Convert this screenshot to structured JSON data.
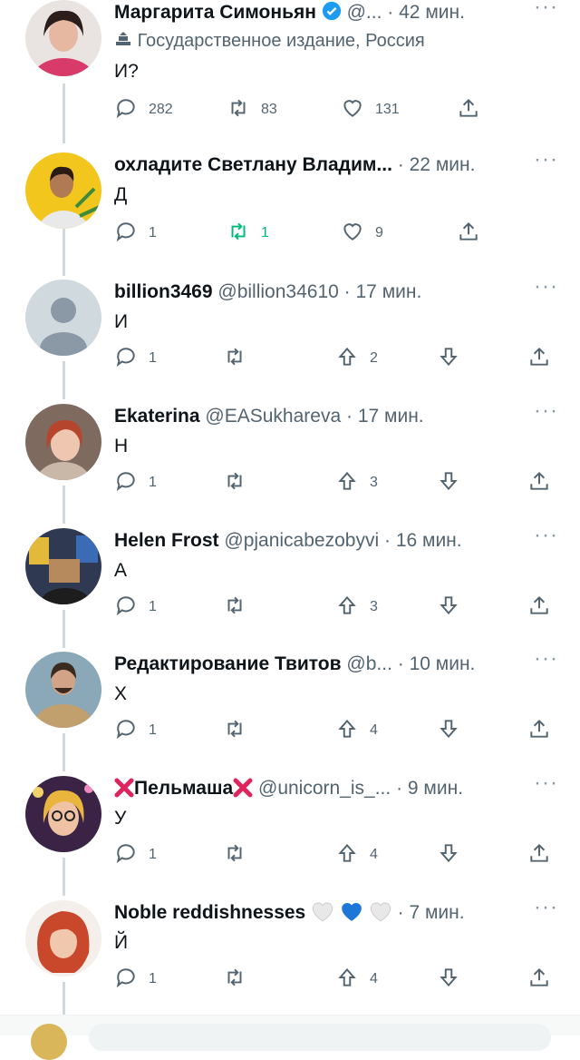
{
  "tweets": [
    {
      "name": "Маргарита Симоньян",
      "verified": true,
      "handle": "@...",
      "time": "42 мин.",
      "label": "Государственное издание, Россия",
      "text": "И?",
      "actions": {
        "replies": "282",
        "retweets": "83",
        "likes": "131"
      }
    },
    {
      "name": "охладите Светлану Владим...",
      "time": "22 мин.",
      "text": "Д",
      "actions": {
        "replies": "1",
        "retweets": "1",
        "likes": "9"
      },
      "retweet_active_color": "#00ba7c"
    },
    {
      "name": "billion3469",
      "handle": "@billion34610",
      "time": "17 мин.",
      "text": "И",
      "actions": {
        "replies": "1",
        "upvotes": "2"
      }
    },
    {
      "name": "Ekaterina",
      "handle": "@EASukhareva",
      "time": "17 мин.",
      "text": "Н",
      "actions": {
        "replies": "1",
        "upvotes": "3"
      }
    },
    {
      "name": "Helen Frost",
      "handle": "@pjanicabezobyvi",
      "time": "16 мин.",
      "text": "А",
      "actions": {
        "replies": "1",
        "upvotes": "3"
      }
    },
    {
      "name": "Редактирование Твитов",
      "handle": "@b...",
      "time": "10 мин.",
      "text": "Х",
      "actions": {
        "replies": "1",
        "upvotes": "4"
      }
    },
    {
      "name": "Пельмаша",
      "handle": "@unicorn_is_...",
      "time": "9 мин.",
      "text": "У",
      "actions": {
        "replies": "1",
        "upvotes": "4"
      }
    },
    {
      "name": "Noble reddishnesses",
      "time": "7 мин.",
      "text": "Й",
      "actions": {
        "replies": "1",
        "upvotes": "4"
      }
    }
  ],
  "separator": "·",
  "more": "···",
  "icons": {
    "reply": "reply-icon",
    "retweet": "retweet-icon",
    "like": "heart-icon",
    "share": "share-icon",
    "upvote": "upvote-icon",
    "downvote": "downvote-icon",
    "verified": "verified-badge-icon",
    "state_media": "state-media-icon"
  },
  "colors": {
    "text": "#0f1419",
    "secondary": "#536471",
    "verified": "#1d9bf0",
    "retweet_active": "#00ba7c",
    "thread_line": "#cfd9de"
  }
}
